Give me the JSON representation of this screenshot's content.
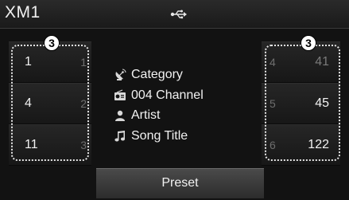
{
  "header": {
    "title": "XM1",
    "status_icon": "usb-icon"
  },
  "callouts": [
    "3",
    "3"
  ],
  "left_presets": [
    {
      "channel": "1",
      "number": "1"
    },
    {
      "channel": "4",
      "number": "2"
    },
    {
      "channel": "11",
      "number": "3"
    }
  ],
  "right_presets": [
    {
      "number": "4",
      "channel": "41"
    },
    {
      "number": "5",
      "channel": "45"
    },
    {
      "number": "6",
      "channel": "122"
    }
  ],
  "info": [
    {
      "icon": "satellite-icon",
      "label": "Category"
    },
    {
      "icon": "radio-icon",
      "label": "004 Channel"
    },
    {
      "icon": "artist-icon",
      "label": "Artist"
    },
    {
      "icon": "music-note-icon",
      "label": "Song Title"
    }
  ],
  "preset_button": {
    "label": "Preset"
  },
  "colors": {
    "background": "#121212",
    "text": "#f2f2f2",
    "dim_text": "#6e6e6e",
    "callout": "#ffffff"
  }
}
